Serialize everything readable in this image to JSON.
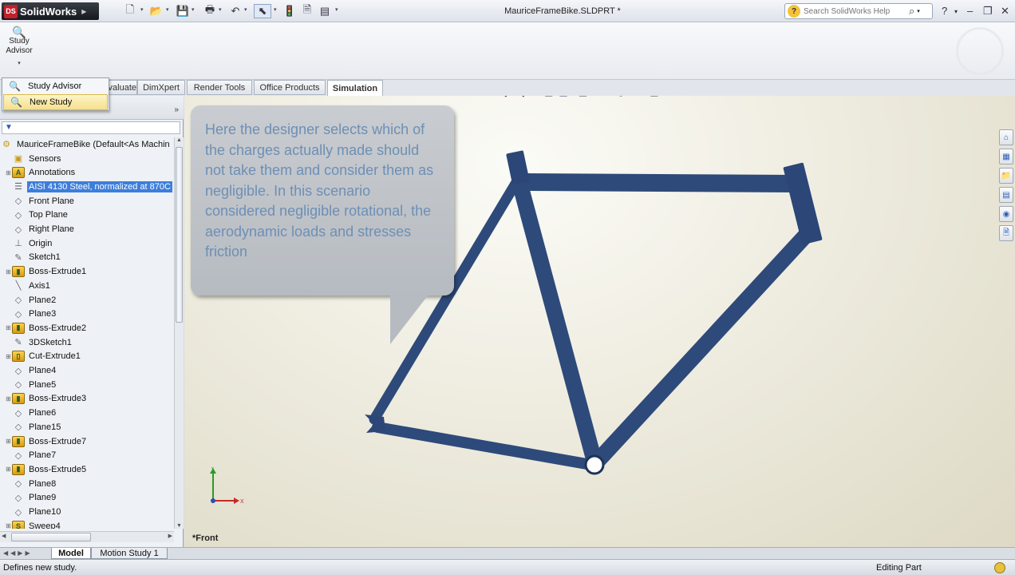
{
  "app": {
    "name": "SolidWorks",
    "document_title": "MauriceFrameBike.SLDPRT *"
  },
  "help_search": {
    "placeholder": "Search SolidWorks Help"
  },
  "command_manager": {
    "study_advisor_label": "Study Advisor"
  },
  "dropdown": {
    "items": [
      {
        "label": "Study Advisor",
        "icon": "study-advisor-icon"
      },
      {
        "label": "New Study",
        "icon": "new-study-icon"
      }
    ]
  },
  "tabs": [
    {
      "label": "Evaluate"
    },
    {
      "label": "DimXpert"
    },
    {
      "label": "Render Tools"
    },
    {
      "label": "Office Products"
    },
    {
      "label": "Simulation",
      "active": true
    }
  ],
  "tree": {
    "root": "MauriceFrameBike  (Default<As Machin",
    "items": [
      {
        "label": "Sensors",
        "icon": "sensors-folder-icon",
        "expandable": false
      },
      {
        "label": "Annotations",
        "icon": "annotations-icon",
        "expandable": true
      },
      {
        "label": "AISI 4130 Steel, normalized at 870C",
        "icon": "material-icon",
        "selected": true
      },
      {
        "label": "Front Plane",
        "icon": "plane-icon"
      },
      {
        "label": "Top Plane",
        "icon": "plane-icon"
      },
      {
        "label": "Right Plane",
        "icon": "plane-icon"
      },
      {
        "label": "Origin",
        "icon": "origin-icon"
      },
      {
        "label": "Sketch1",
        "icon": "sketch-icon"
      },
      {
        "label": "Boss-Extrude1",
        "icon": "extrude-icon",
        "expandable": true
      },
      {
        "label": "Axis1",
        "icon": "axis-icon"
      },
      {
        "label": "Plane2",
        "icon": "plane-icon"
      },
      {
        "label": "Plane3",
        "icon": "plane-icon"
      },
      {
        "label": "Boss-Extrude2",
        "icon": "extrude-icon",
        "expandable": true
      },
      {
        "label": "3DSketch1",
        "icon": "3dsketch-icon"
      },
      {
        "label": "Cut-Extrude1",
        "icon": "cut-extrude-icon",
        "expandable": true
      },
      {
        "label": "Plane4",
        "icon": "plane-icon"
      },
      {
        "label": "Plane5",
        "icon": "plane-icon"
      },
      {
        "label": "Boss-Extrude3",
        "icon": "extrude-icon",
        "expandable": true
      },
      {
        "label": "Plane6",
        "icon": "plane-icon"
      },
      {
        "label": "Plane15",
        "icon": "plane-icon"
      },
      {
        "label": "Boss-Extrude7",
        "icon": "extrude-icon",
        "expandable": true
      },
      {
        "label": "Plane7",
        "icon": "plane-icon"
      },
      {
        "label": "Boss-Extrude5",
        "icon": "extrude-icon",
        "expandable": true
      },
      {
        "label": "Plane8",
        "icon": "plane-icon"
      },
      {
        "label": "Plane9",
        "icon": "plane-icon"
      },
      {
        "label": "Plane10",
        "icon": "plane-icon"
      },
      {
        "label": "Sweep4",
        "icon": "sweep-icon",
        "expandable": true
      }
    ]
  },
  "callout": {
    "text": "Here the designer selects which of the charges actually made should not take them and consider them as negligible. In this scenario considered negligible rotational, the aerodynamic loads and stresses friction"
  },
  "graphics": {
    "view_label": "*Front",
    "frame_color": "#2e4a7a",
    "triad": {
      "x_label": "X",
      "y_label": "Y"
    }
  },
  "bottom_tabs": [
    {
      "label": "Model",
      "active": true
    },
    {
      "label": "Motion Study 1"
    }
  ],
  "status": {
    "message": "Defines new study.",
    "mode": "Editing Part"
  }
}
